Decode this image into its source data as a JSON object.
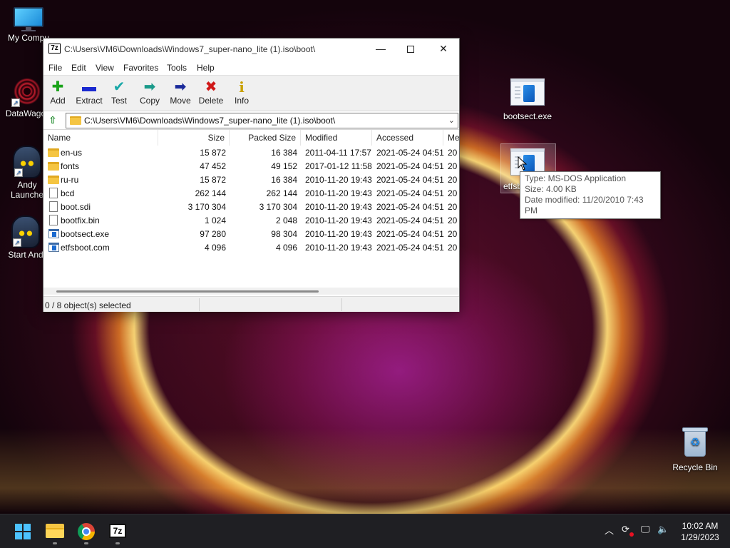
{
  "desktop": {
    "icons": [
      {
        "label": "My Compu"
      },
      {
        "label": "DataWagor"
      },
      {
        "label": "Andy\nLaunche"
      },
      {
        "label": "Start And"
      },
      {
        "label": "bootsect.exe"
      },
      {
        "label": "etfsb"
      },
      {
        "label": "Recycle Bin"
      }
    ],
    "tooltip": {
      "type": "Type: MS-DOS Application",
      "size": "Size: 4.00 KB",
      "modified": "Date modified: 11/20/2010 7:43 PM"
    }
  },
  "window": {
    "app_icon": "7z",
    "title": "C:\\Users\\VM6\\Downloads\\Windows7_super-nano_lite (1).iso\\boot\\",
    "controls": {
      "minimize": "—",
      "close": "✕"
    },
    "menu": [
      "File",
      "Edit",
      "View",
      "Favorites",
      "Tools",
      "Help"
    ],
    "toolbar": [
      {
        "label": "Add",
        "icon": "plus-icon",
        "glyph": "✚",
        "color": "#1aa31a"
      },
      {
        "label": "Extract",
        "icon": "minus-icon",
        "glyph": "▬",
        "color": "#1a2ad0"
      },
      {
        "label": "Test",
        "icon": "check-icon",
        "glyph": "✔",
        "color": "#1aa8a8"
      },
      {
        "label": "Copy",
        "icon": "copy-arrow-icon",
        "glyph": "➡",
        "color": "#1a9a8a"
      },
      {
        "label": "Move",
        "icon": "move-arrow-icon",
        "glyph": "➡",
        "color": "#1a2a9a"
      },
      {
        "label": "Delete",
        "icon": "delete-x-icon",
        "glyph": "✖",
        "color": "#d01818"
      },
      {
        "label": "Info",
        "icon": "info-icon",
        "glyph": "i",
        "color": "#c8a000"
      }
    ],
    "address": {
      "up_glyph": "⇧",
      "path": "C:\\Users\\VM6\\Downloads\\Windows7_super-nano_lite (1).iso\\boot\\",
      "dropdown_glyph": "⌄"
    },
    "columns": [
      "Name",
      "Size",
      "Packed Size",
      "Modified",
      "Accessed",
      "Me"
    ],
    "files": [
      {
        "type": "folder",
        "name": "en-us",
        "size": "15 872",
        "packed": "16 384",
        "modified": "2011-04-11 17:57",
        "accessed": "2021-05-24 04:51",
        "me": "20"
      },
      {
        "type": "folder",
        "name": "fonts",
        "size": "47 452",
        "packed": "49 152",
        "modified": "2017-01-12 11:58",
        "accessed": "2021-05-24 04:51",
        "me": "20"
      },
      {
        "type": "folder",
        "name": "ru-ru",
        "size": "15 872",
        "packed": "16 384",
        "modified": "2010-11-20 19:43",
        "accessed": "2021-05-24 04:51",
        "me": "20"
      },
      {
        "type": "file",
        "name": "bcd",
        "size": "262 144",
        "packed": "262 144",
        "modified": "2010-11-20 19:43",
        "accessed": "2021-05-24 04:51",
        "me": "20"
      },
      {
        "type": "file",
        "name": "boot.sdi",
        "size": "3 170 304",
        "packed": "3 170 304",
        "modified": "2010-11-20 19:43",
        "accessed": "2021-05-24 04:51",
        "me": "20"
      },
      {
        "type": "file",
        "name": "bootfix.bin",
        "size": "1 024",
        "packed": "2 048",
        "modified": "2010-11-20 19:43",
        "accessed": "2021-05-24 04:51",
        "me": "20"
      },
      {
        "type": "exe",
        "name": "bootsect.exe",
        "size": "97 280",
        "packed": "98 304",
        "modified": "2010-11-20 19:43",
        "accessed": "2021-05-24 04:51",
        "me": "20"
      },
      {
        "type": "exe",
        "name": "etfsboot.com",
        "size": "4 096",
        "packed": "4 096",
        "modified": "2010-11-20 19:43",
        "accessed": "2021-05-24 04:51",
        "me": "20"
      }
    ],
    "status": "0 / 8 object(s) selected"
  },
  "taskbar": {
    "pinned": [
      "start",
      "file-explorer",
      "chrome",
      "7-zip"
    ],
    "zip_label": "7z",
    "tray": {
      "chevron": "︿",
      "sync": "⟳",
      "network": "🖵",
      "volume": "🔈"
    },
    "time": "10:02 AM",
    "date": "1/29/2023"
  }
}
